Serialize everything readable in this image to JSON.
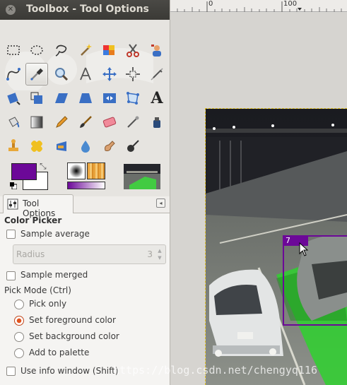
{
  "window": {
    "title": "Toolbox - Tool Options"
  },
  "toolbox": {
    "tools": [
      {
        "name": "rect-select-icon"
      },
      {
        "name": "ellipse-select-icon"
      },
      {
        "name": "free-select-icon"
      },
      {
        "name": "fuzzy-select-icon"
      },
      {
        "name": "select-by-color-icon"
      },
      {
        "name": "scissors-select-icon"
      },
      {
        "name": "foreground-select-icon"
      },
      {
        "name": "paths-icon"
      },
      {
        "name": "color-picker-icon",
        "active": true
      },
      {
        "name": "zoom-icon"
      },
      {
        "name": "measure-icon"
      },
      {
        "name": "move-icon"
      },
      {
        "name": "align-icon"
      },
      {
        "name": "crop-icon"
      },
      {
        "name": "rotate-icon"
      },
      {
        "name": "scale-icon"
      },
      {
        "name": "shear-icon"
      },
      {
        "name": "perspective-icon"
      },
      {
        "name": "flip-icon"
      },
      {
        "name": "cage-transform-icon"
      },
      {
        "name": "text-tool-icon",
        "glyph": "A"
      },
      {
        "name": "bucket-fill-icon"
      },
      {
        "name": "blend-icon"
      },
      {
        "name": "pencil-icon"
      },
      {
        "name": "paintbrush-icon"
      },
      {
        "name": "eraser-icon"
      },
      {
        "name": "airbrush-icon"
      },
      {
        "name": "ink-icon"
      },
      {
        "name": "clone-icon"
      },
      {
        "name": "heal-icon"
      },
      {
        "name": "perspective-clone-icon"
      },
      {
        "name": "blur-icon"
      },
      {
        "name": "smudge-icon"
      },
      {
        "name": "dodge-burn-icon"
      }
    ],
    "colors": {
      "foreground": "#6c0898",
      "background": "#ffffff"
    }
  },
  "dock": {
    "tab_label": "Tool Options"
  },
  "tool_options": {
    "tool_name": "Color Picker",
    "sample_average": {
      "label": "Sample average",
      "checked": false
    },
    "radius": {
      "label": "Radius",
      "value": "3"
    },
    "sample_merged": {
      "label": "Sample merged",
      "checked": false
    },
    "pick_mode": {
      "label": "Pick Mode  (Ctrl)",
      "options": [
        "Pick only",
        "Set foreground color",
        "Set background color",
        "Add to palette"
      ],
      "selected": "Set foreground color"
    },
    "use_info_window": {
      "label": "Use info window  (Shift)",
      "checked": false
    }
  },
  "image_window": {
    "ruler": {
      "tick_0": "0",
      "tick_100": "100"
    },
    "bbox_label": "7",
    "watermark": "https://blog.csdn.net/chengyq116"
  }
}
